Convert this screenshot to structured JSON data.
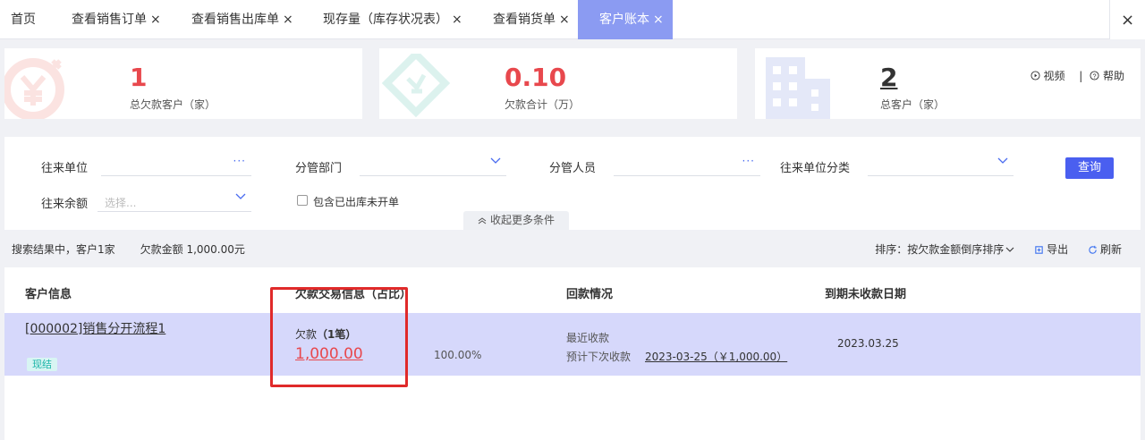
{
  "tabs": [
    {
      "label": "首页",
      "closable": false,
      "active": false
    },
    {
      "label": "查看销售订单",
      "closable": true,
      "active": false
    },
    {
      "label": "查看销售出库单",
      "closable": true,
      "active": false
    },
    {
      "label": "现存量（库存状况表）",
      "closable": true,
      "active": false
    },
    {
      "label": "查看销货单",
      "closable": true,
      "active": false
    },
    {
      "label": "客户账本",
      "closable": true,
      "active": true
    }
  ],
  "tab_close_symbol": "×",
  "close_all_symbol": "×",
  "summary": {
    "debt_customers": {
      "value": "1",
      "label": "总欠款客户（家）",
      "icon": "yen-coin-icon"
    },
    "debt_total": {
      "value": "0.10",
      "label": "欠款合计（万）",
      "icon": "voucher-icon"
    },
    "total_customers": {
      "value": "2",
      "label": "总客户（家）",
      "icon": "building-icon"
    },
    "video_label": "视频",
    "help_label": "帮助",
    "separator": "|"
  },
  "filters": {
    "partner_unit": {
      "label": "往来单位",
      "value": ""
    },
    "department": {
      "label": "分管部门",
      "value": ""
    },
    "staff": {
      "label": "分管人员",
      "value": ""
    },
    "partner_category": {
      "label": "往来单位分类",
      "value": ""
    },
    "balance": {
      "label": "往来余额",
      "placeholder": "选择..."
    },
    "include_shipped_label": "包含已出库未开单",
    "include_shipped_checked": false,
    "query_button": "查询",
    "collapse_label": "收起更多条件",
    "more_symbol": "···"
  },
  "result": {
    "search_summary": "搜索结果中，客户1家",
    "debt_amount": "欠款金额 1,000.00元",
    "sort_label": "排序：按欠款金额倒序排序",
    "export_label": "导出",
    "refresh_label": "刷新"
  },
  "table": {
    "headers": [
      "客户信息",
      "欠款交易信息（占比）",
      "回款情况",
      "到期未收款日期"
    ],
    "rows": [
      {
        "customer": "[000002]销售分开流程1",
        "badge": "现结",
        "debt_title": "欠款",
        "debt_count": "（1笔）",
        "debt_amount": "1,000.00",
        "ratio": "100.00%",
        "recent_label": "最近收款",
        "next_label": "预计下次收款",
        "next_value": "2023-03-25（￥1,000.00）",
        "due_date": "2023.03.25"
      }
    ]
  },
  "colors": {
    "active_tab": "#8b9bf2",
    "accent_red": "#e8484d",
    "primary_blue": "#4a5ff0",
    "row_highlight": "#d6d8fb",
    "annotation_red": "#e02a2a"
  }
}
